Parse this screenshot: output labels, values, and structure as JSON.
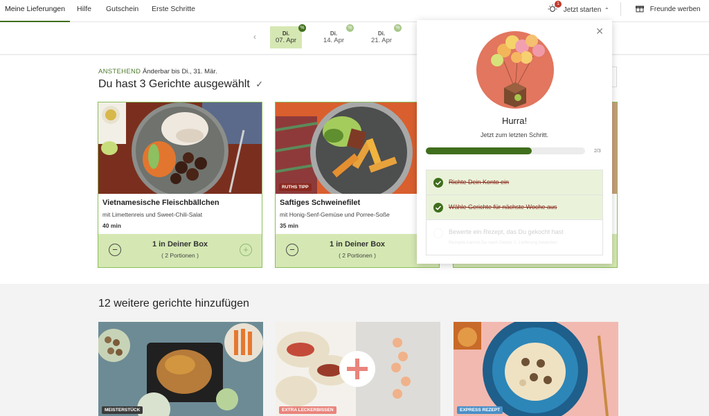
{
  "nav": {
    "items": [
      "Meine Lieferungen",
      "Hilfe",
      "Gutschein",
      "Erste Schritte"
    ],
    "get_started": "Jetzt starten",
    "notif_count": "1",
    "refer": "Freunde werben"
  },
  "dates": [
    {
      "day": "Di.",
      "date": "07. Apr"
    },
    {
      "day": "Di.",
      "date": "14. Apr"
    },
    {
      "day": "Di.",
      "date": "21. Apr"
    }
  ],
  "upcoming": {
    "tag": "ANSTEHEND",
    "changeable": "Änderbar bis Di., 31. Mär.",
    "heading": "Du hast 3 Gerichte ausgewählt"
  },
  "recipes": [
    {
      "title": "Vietnamesische Fleischbällchen",
      "subtitle": "mit Limettenreis und Sweet-Chili-Salat",
      "time": "40 min",
      "count": "1 in Deiner Box",
      "portions": "( 2 Portionen )"
    },
    {
      "badge": "RUTHS TIPP",
      "title": "Saftiges Schweinefilet",
      "subtitle": "mit Honig-Senf-Gemüse und Porree-Soße",
      "time": "35 min",
      "count": "1 in Deiner Box",
      "portions": "( 2 Portionen )"
    }
  ],
  "more": {
    "heading": "12 weitere gerichte hinzufügen",
    "badges": [
      {
        "label": "MEISTERSTÜCK",
        "color": "#3b3b3b"
      },
      {
        "label": "EXTRA LECKERBISSEN",
        "color": "#e9847c"
      },
      {
        "label": "EXPRESS REZEPT",
        "color": "#4a90c8"
      }
    ]
  },
  "popup": {
    "title": "Hurra!",
    "subtitle": "Jetzt zum letzten Schritt.",
    "progress": 0.667,
    "progress_label": "2/3",
    "steps": [
      {
        "label": "Richte Dein Konto ein",
        "done": true
      },
      {
        "label": "Wähle Gerichte für nächste Woche aus",
        "done": true
      },
      {
        "label": "Bewerte ein Rezept, das Du gekocht hast",
        "sub": "Rezepte kannst Du nach Deiner 1. Lieferung bewerten",
        "done": false
      }
    ]
  },
  "colors": {
    "brand_green": "#3f6e1c",
    "light_green": "#d5e8b3",
    "accent_red": "#8a2a1e"
  }
}
